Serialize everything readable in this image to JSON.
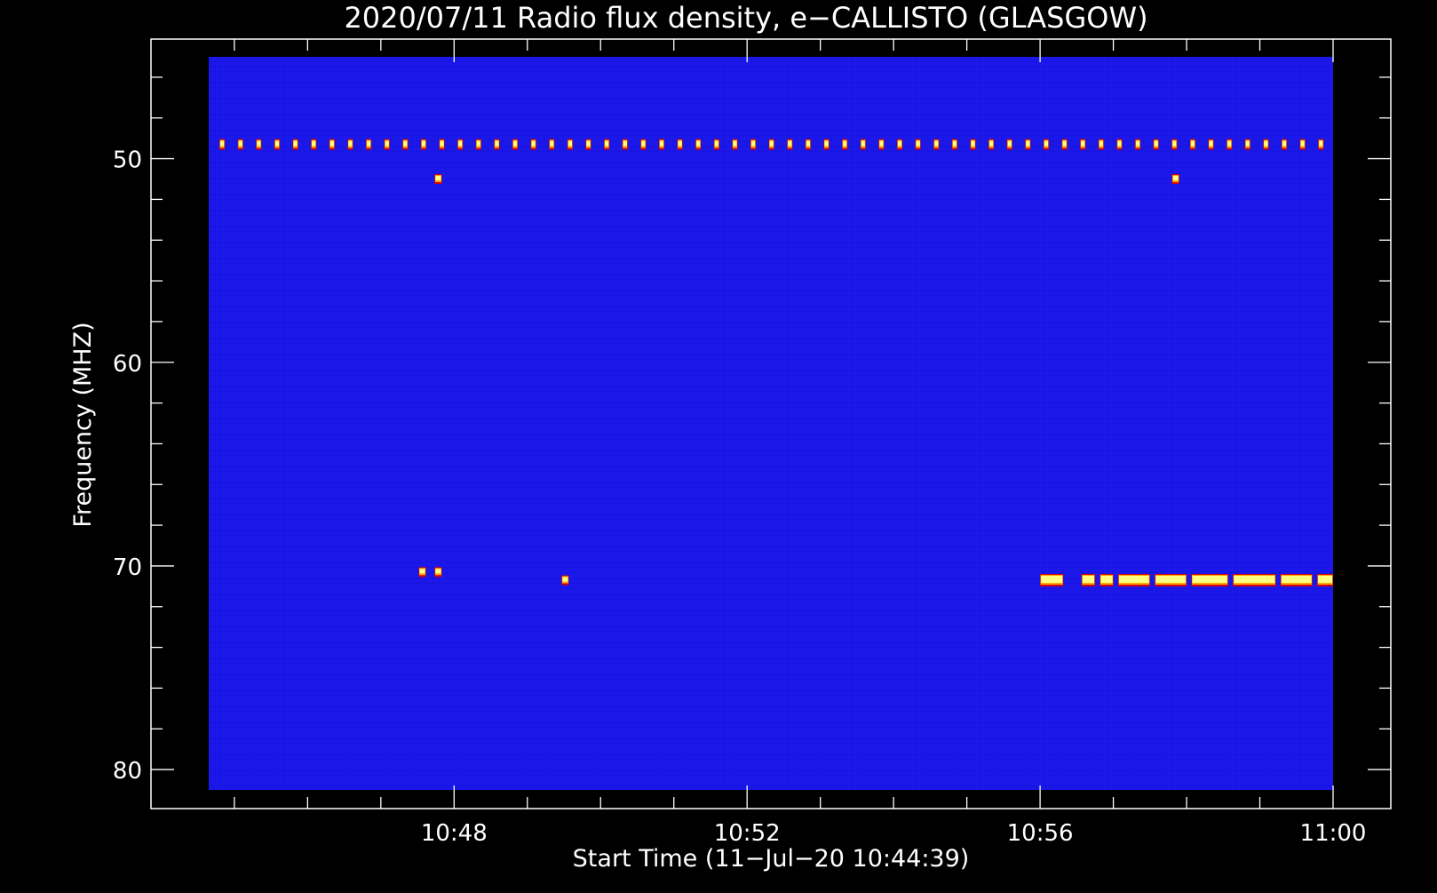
{
  "chart_data": {
    "type": "heatmap",
    "title": "2020/07/11  Radio flux density, e−CALLISTO (GLASGOW)",
    "xlabel": "Start Time (11−Jul−20 10:44:39)",
    "ylabel": "Frequency (MHZ)",
    "x_axis": {
      "unit": "time",
      "range": [
        "10:44:39",
        "11:00:00"
      ],
      "ticks": [
        {
          "value": "10:48",
          "label": "10:48"
        },
        {
          "value": "10:52",
          "label": "10:52"
        },
        {
          "value": "10:56",
          "label": "10:56"
        },
        {
          "value": "11:00",
          "label": "11:00"
        }
      ]
    },
    "y_axis": {
      "unit": "MHz",
      "range": [
        45,
        81
      ],
      "inverted": true,
      "ticks": [
        {
          "value": 50,
          "label": "50"
        },
        {
          "value": 60,
          "label": "60"
        },
        {
          "value": 70,
          "label": "70"
        },
        {
          "value": 80,
          "label": "80"
        }
      ]
    },
    "grid": false,
    "colors": {
      "background": "#000000",
      "field": "#1a17e8",
      "frame": "#ffffff",
      "hot_outer": "#d8000a",
      "hot_mid": "#ffa500",
      "hot_core": "#ffff80"
    },
    "features": {
      "periodic_line": {
        "frequency_mhz": 49.3,
        "start": "10:44:50",
        "end": "10:59:50",
        "period_seconds": 15
      },
      "isolated_spots": [
        {
          "time": "10:47:47",
          "frequency_mhz": 51.0
        },
        {
          "time": "10:57:51",
          "frequency_mhz": 51.0
        },
        {
          "time": "10:49:31",
          "frequency_mhz": 70.7
        },
        {
          "time": "10:47:34",
          "frequency_mhz": 70.3
        },
        {
          "time": "10:47:47",
          "frequency_mhz": 70.3
        }
      ],
      "burst_band": {
        "frequency_mhz": 70.7,
        "segments": [
          [
            "10:56:00",
            "10:56:19"
          ],
          [
            "10:56:34",
            "10:56:45"
          ],
          [
            "10:56:49",
            "10:57:00"
          ],
          [
            "10:57:04",
            "10:57:30"
          ],
          [
            "10:57:34",
            "10:58:00"
          ],
          [
            "10:58:04",
            "10:58:34"
          ],
          [
            "10:58:38",
            "10:59:13"
          ],
          [
            "10:59:17",
            "10:59:43"
          ],
          [
            "10:59:47",
            "11:00:00"
          ]
        ]
      }
    }
  }
}
